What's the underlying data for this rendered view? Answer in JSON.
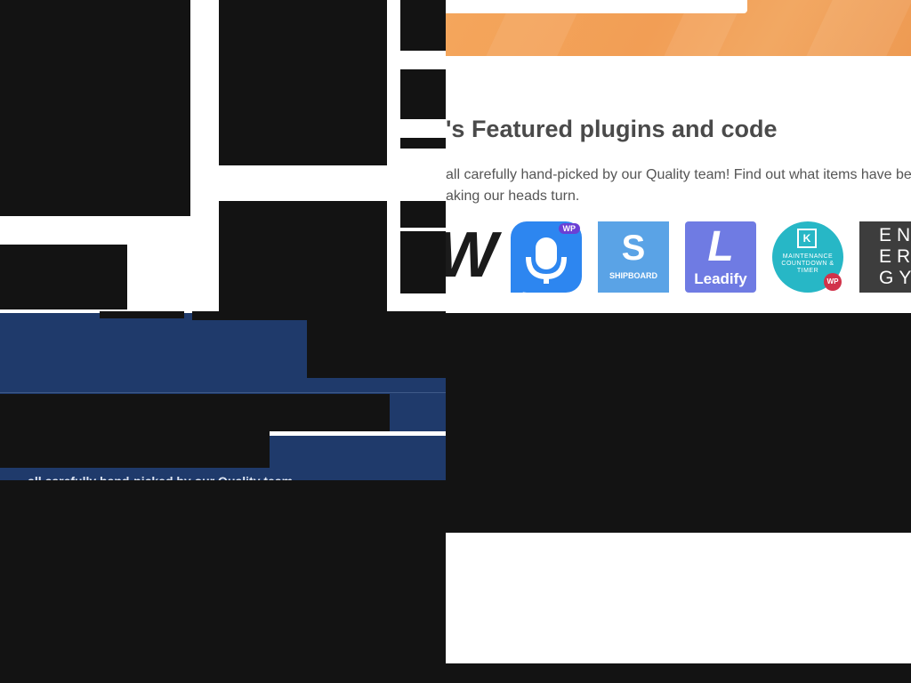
{
  "featured": {
    "title": "'s Featured plugins and code",
    "desc_line1": "all carefully hand-picked by our Quality team! Find out what items have bee",
    "desc_line2": "aking our heads turn."
  },
  "tiles": [
    {
      "name": "partial-w-logo",
      "glyph": "W"
    },
    {
      "name": "voice-wp",
      "badge": "WP"
    },
    {
      "name": "shipboard",
      "label": "SHIPBOARD",
      "glyph": "S"
    },
    {
      "name": "leadify",
      "label": "Leadify",
      "glyph": "L"
    },
    {
      "name": "maintenance-countdown",
      "label": "MAINTENANCE COUNTDOWN & TIMER",
      "glyph": "K",
      "badge": "WP"
    },
    {
      "name": "energy",
      "lines": [
        "EN",
        "ER",
        "GY"
      ]
    }
  ],
  "hidden_text": "- - all carefully hand-picked by our Quality team",
  "colors": {
    "hero_orange": "#f2a25a",
    "navy": "#1f3a6b",
    "redaction": "#131313",
    "voice_blue": "#2d86f0",
    "shipboard_blue": "#5aa3e6",
    "leadify_purple": "#6f7be3",
    "maintenance_teal": "#27b7c6",
    "energy_gray": "#3d3d3d"
  }
}
